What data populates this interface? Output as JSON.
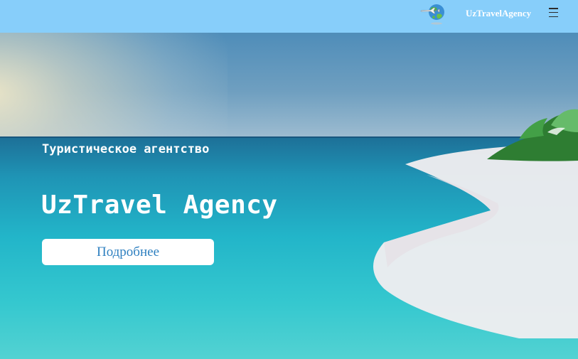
{
  "navbar": {
    "logo_icon": "globe-airplane-logo-icon",
    "brand": "UzTravelAgency",
    "menu_icon": "hamburger-menu-icon"
  },
  "hero": {
    "background_icon": "tropical-beach-photo",
    "subtitle": "Туристическое агентство",
    "title": "UzTravel Agency",
    "button_label": "Подробнее"
  },
  "colors": {
    "navbar_bg": "#87cefa",
    "button_text": "#2f80c0",
    "text": "#ffffff"
  }
}
